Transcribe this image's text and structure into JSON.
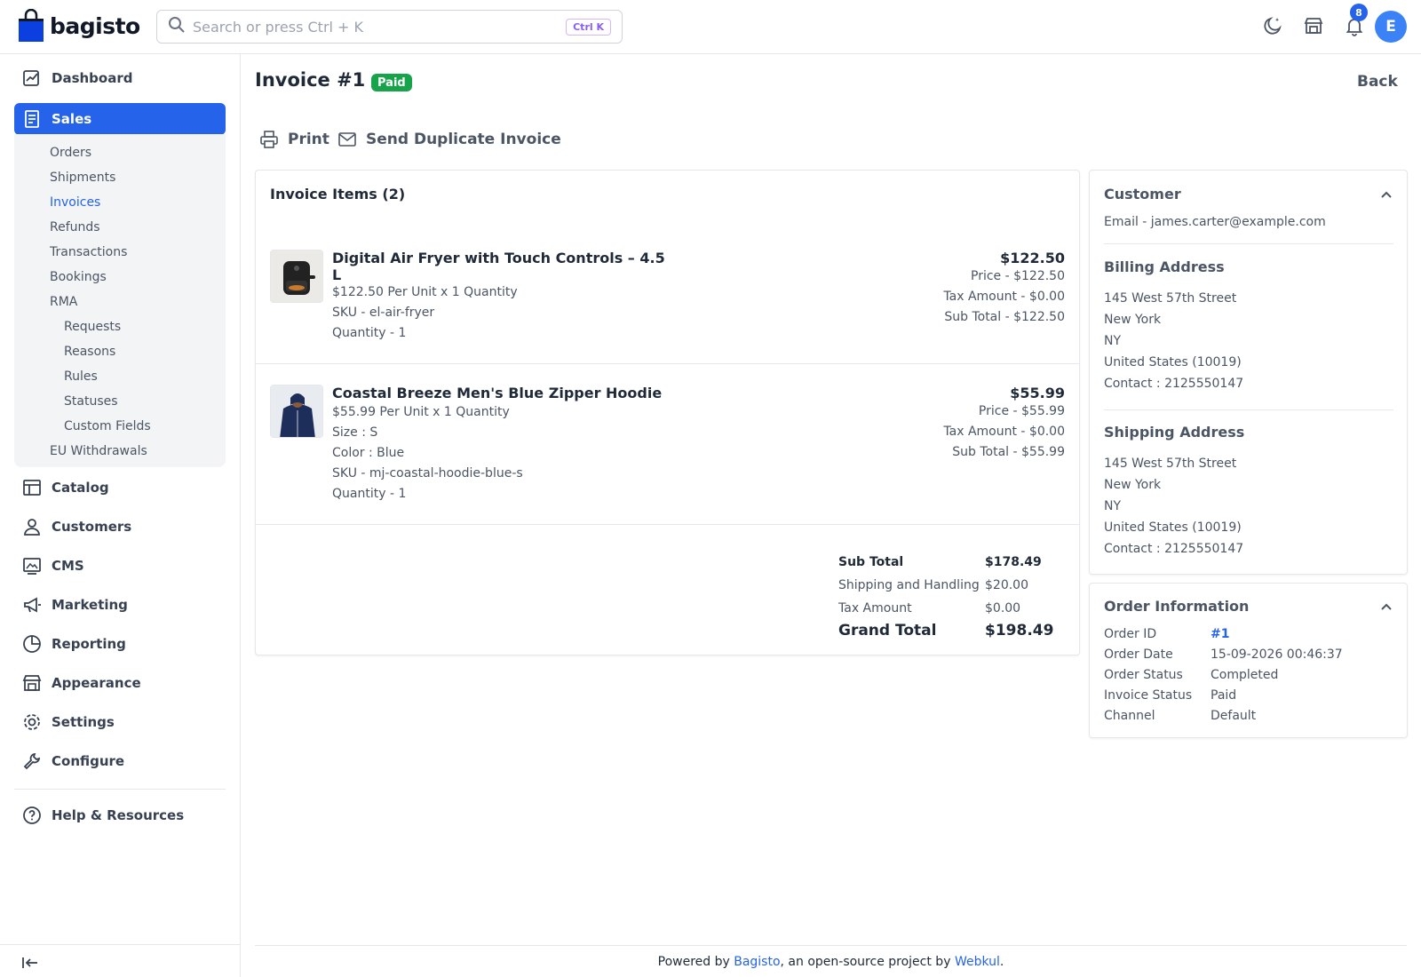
{
  "header": {
    "logo_text": "bagisto",
    "search_placeholder": "Search or press Ctrl + K",
    "search_shortcut": "Ctrl K",
    "notification_count": "8",
    "avatar_initial": "E",
    "icons": [
      "moon-icon",
      "store-icon",
      "bell-icon"
    ]
  },
  "sidebar": {
    "items": [
      {
        "label": "Dashboard",
        "icon": "dashboard-icon"
      },
      {
        "label": "Sales",
        "icon": "sales-icon",
        "active": true
      },
      {
        "label": "Catalog",
        "icon": "catalog-icon"
      },
      {
        "label": "Customers",
        "icon": "customers-icon"
      },
      {
        "label": "CMS",
        "icon": "cms-icon"
      },
      {
        "label": "Marketing",
        "icon": "marketing-icon"
      },
      {
        "label": "Reporting",
        "icon": "reporting-icon"
      },
      {
        "label": "Appearance",
        "icon": "appearance-icon"
      },
      {
        "label": "Settings",
        "icon": "settings-icon"
      },
      {
        "label": "Configure",
        "icon": "configure-icon"
      }
    ],
    "sales_sub": [
      "Orders",
      "Shipments",
      "Invoices",
      "Refunds",
      "Transactions",
      "Bookings",
      "RMA",
      "EU Withdrawals"
    ],
    "rma_sub": [
      "Requests",
      "Reasons",
      "Rules",
      "Statuses",
      "Custom Fields"
    ],
    "help": "Help & Resources",
    "accent": "#2563eb"
  },
  "page": {
    "title": "Invoice #1",
    "status_badge": "Paid",
    "back": "Back",
    "actions": {
      "print": "Print",
      "send": "Send Duplicate Invoice"
    }
  },
  "invoice_items": {
    "title": "Invoice Items (2)",
    "items": [
      {
        "name": "Digital Air Fryer with Touch Controls – 4.5 L",
        "unit_line": "$122.50 Per Unit x 1 Quantity",
        "attributes": [],
        "sku": "SKU - el-air-fryer",
        "quantity": "Quantity - 1",
        "total": "$122.50",
        "price": "Price - $122.50",
        "tax": "Tax Amount - $0.00",
        "subtotal": "Sub Total - $122.50"
      },
      {
        "name": "Coastal Breeze Men's Blue Zipper Hoodie",
        "unit_line": "$55.99 Per Unit x 1 Quantity",
        "attributes": [
          "Size : S",
          "Color : Blue"
        ],
        "sku": "SKU - mj-coastal-hoodie-blue-s",
        "quantity": "Quantity - 1",
        "total": "$55.99",
        "price": "Price - $55.99",
        "tax": "Tax Amount - $0.00",
        "subtotal": "Sub Total - $55.99"
      }
    ]
  },
  "totals": {
    "sub_total_label": "Sub Total",
    "sub_total": "$178.49",
    "shipping_label": "Shipping and Handling",
    "shipping": "$20.00",
    "tax_label": "Tax Amount",
    "tax": "$0.00",
    "grand_total_label": "Grand Total",
    "grand_total": "$198.49"
  },
  "customer": {
    "title": "Customer",
    "email": "Email - james.carter@example.com",
    "billing_title": "Billing Address",
    "billing": [
      "145 West 57th Street",
      "New York",
      "NY",
      "United States (10019)",
      "Contact : 2125550147"
    ],
    "shipping_title": "Shipping Address",
    "shipping": [
      "145 West 57th Street",
      "New York",
      "NY",
      "United States (10019)",
      "Contact : 2125550147"
    ]
  },
  "order_info": {
    "title": "Order Information",
    "rows": [
      {
        "label": "Order ID",
        "value": "#1"
      },
      {
        "label": "Order Date",
        "value": "15-09-2026 00:46:37"
      },
      {
        "label": "Order Status",
        "value": "Completed"
      },
      {
        "label": "Invoice Status",
        "value": "Paid"
      },
      {
        "label": "Channel",
        "value": "Default"
      }
    ]
  },
  "footer": {
    "prefix": "Powered by ",
    "link1": "Bagisto",
    "middle": ", an open-source project by ",
    "link2": "Webkul",
    "suffix": "."
  }
}
